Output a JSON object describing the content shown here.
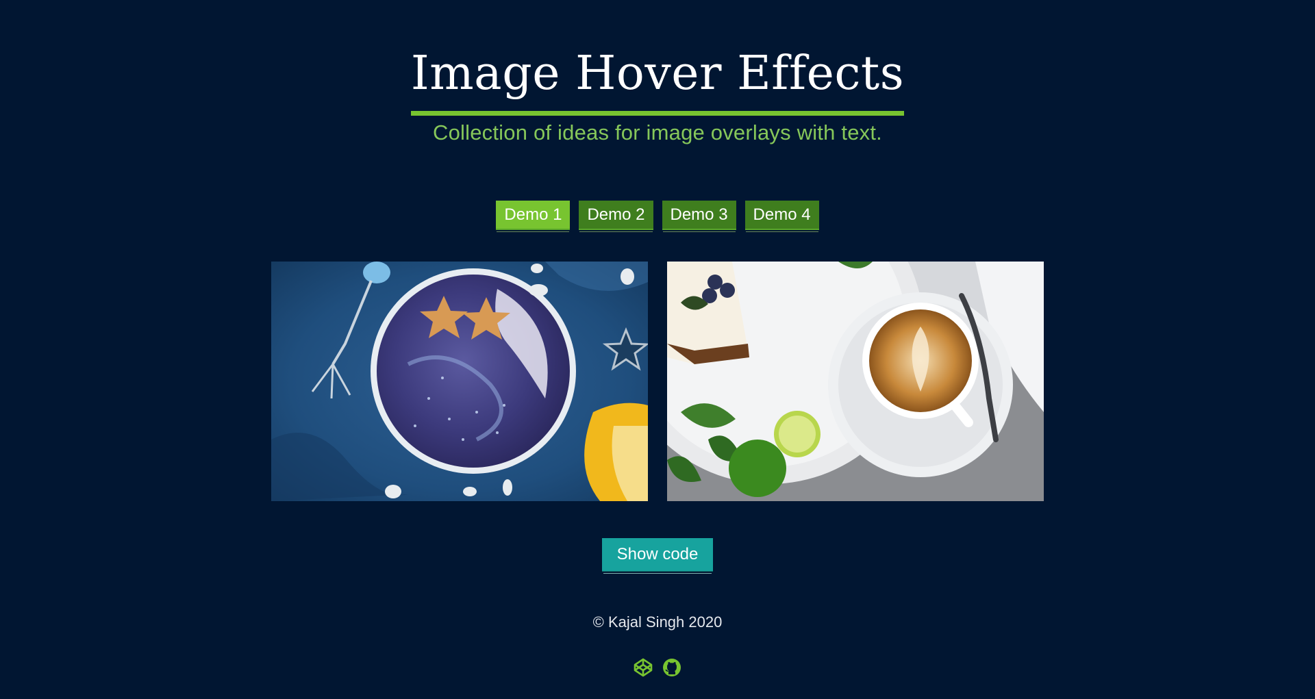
{
  "header": {
    "title": "Image Hover Effects",
    "subtitle": "Collection of ideas for image overlays with text."
  },
  "demo_tabs": [
    {
      "label": "Demo 1",
      "active": true
    },
    {
      "label": "Demo 2",
      "active": false
    },
    {
      "label": "Demo 3",
      "active": false
    },
    {
      "label": "Demo 4",
      "active": false
    }
  ],
  "gallery": {
    "images": [
      {
        "subject": "smoothie-bowl-photo"
      },
      {
        "subject": "coffee-and-cake-photo"
      }
    ]
  },
  "actions": {
    "show_code_label": "Show code"
  },
  "footer": {
    "copyright": "© Kajal Singh 2020",
    "social_icons": [
      "codepen-icon",
      "github-icon"
    ]
  },
  "colors": {
    "background": "#011632",
    "accent_green": "#78c430",
    "tab_inactive": "#3f7e1e",
    "subtitle_green": "#86c75a",
    "button_teal": "#17a39e"
  }
}
